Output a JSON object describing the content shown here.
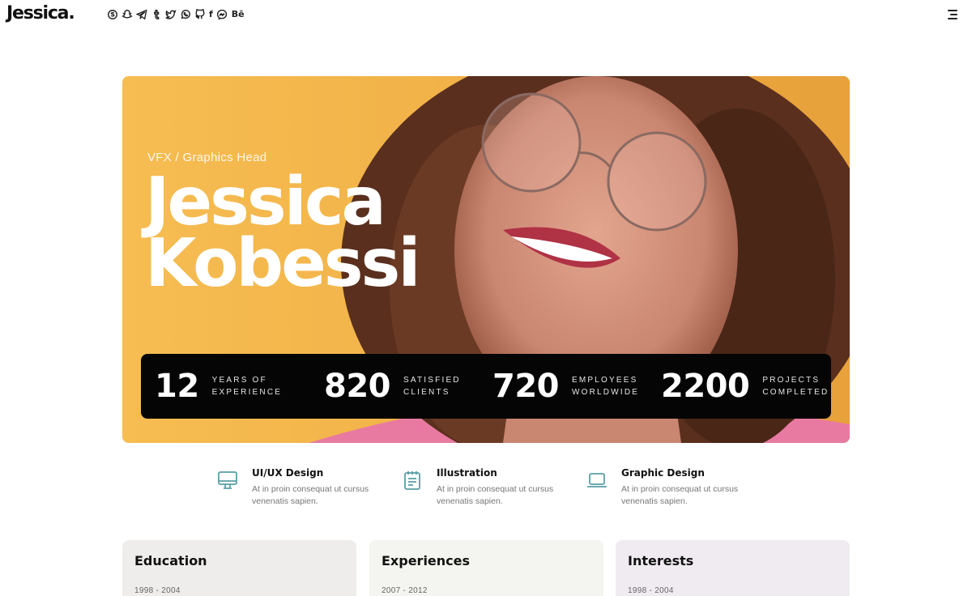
{
  "header": {
    "logo": "Jessica.",
    "socials": [
      {
        "icon": "skype-icon"
      },
      {
        "icon": "snapchat-icon"
      },
      {
        "icon": "telegram-icon"
      },
      {
        "icon": "tumblr-icon"
      },
      {
        "icon": "twitter-icon"
      },
      {
        "icon": "whatsapp-icon"
      },
      {
        "icon": "github-icon"
      },
      {
        "icon": "facebook-icon",
        "label": "f"
      },
      {
        "icon": "messenger-icon"
      },
      {
        "icon": "behance-icon",
        "label": "Bē"
      }
    ],
    "menu_icon": "hamburger-menu-icon"
  },
  "hero": {
    "subtitle": "VFX / Graphics Head",
    "first_name": "Jessica",
    "last_name": "Kobessi",
    "stats": [
      {
        "value": "12",
        "label_1": "YEARS OF",
        "label_2": "EXPERIENCE"
      },
      {
        "value": "820",
        "label_1": "SATISFIED",
        "label_2": "CLIENTS"
      },
      {
        "value": "720",
        "label_1": "EMPLOYEES",
        "label_2": "WORLDWIDE"
      },
      {
        "value": "2200",
        "label_1": "PROJECTS",
        "label_2": "COMPLETED"
      }
    ]
  },
  "services": [
    {
      "icon": "monitor-icon",
      "title": "UI/UX Design",
      "desc": "At in proin consequat ut cursus venenatis sapien."
    },
    {
      "icon": "notepad-icon",
      "title": "Illustration",
      "desc": "At in proin consequat ut cursus venenatis sapien."
    },
    {
      "icon": "laptop-icon",
      "title": "Graphic Design",
      "desc": "At in proin consequat ut cursus venenatis sapien."
    }
  ],
  "cards": [
    {
      "title": "Education",
      "date": "1998 - 2004",
      "bg": "#efecec"
    },
    {
      "title": "Experiences",
      "date": "2007 - 2012",
      "bg": "#f4f5f0"
    },
    {
      "title": "Interests",
      "date": "1998 - 2004",
      "bg": "#efebf0"
    }
  ],
  "colors": {
    "hero_bg": "#f4b044",
    "stats_bar": "#050505",
    "icon_accent": "#5a9ea6"
  }
}
